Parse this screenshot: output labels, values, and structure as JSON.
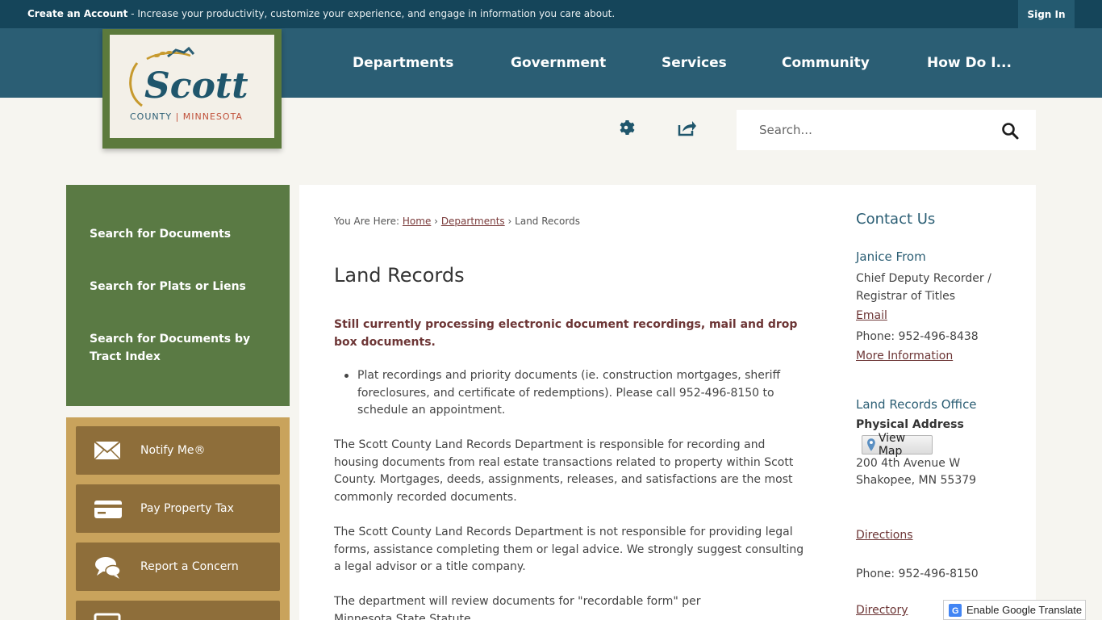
{
  "topbar": {
    "create_account": "Create an Account",
    "promo_text": " - Increase your productivity, customize your experience, and engage in information you care about.",
    "sign_in": "Sign In"
  },
  "logo": {
    "name": "Scott",
    "subtitle_left": "COUNTY",
    "subtitle_right": "MINNESOTA"
  },
  "nav": {
    "items": [
      "Departments",
      "Government",
      "Services",
      "Community",
      "How Do I..."
    ]
  },
  "utility": {
    "settings_icon": "gear-icon",
    "share_icon": "share-icon"
  },
  "search": {
    "placeholder": "Search...",
    "icon": "search-icon"
  },
  "sidenav": {
    "items": [
      "Search for Documents",
      "Search for Plats or Liens",
      "Search for Documents by Tract Index"
    ]
  },
  "quicklinks": [
    {
      "label": "Notify Me®",
      "icon": "envelope-icon"
    },
    {
      "label": "Pay Property Tax",
      "icon": "credit-card-icon"
    },
    {
      "label": "Report a Concern",
      "icon": "chat-bubbles-icon"
    },
    {
      "label": "",
      "icon": "monitor-icon"
    }
  ],
  "breadcrumb": {
    "prefix": "You Are Here:",
    "home": "Home",
    "departments": "Departments",
    "current": "Land Records",
    "sep": "›"
  },
  "page": {
    "title": "Land Records",
    "alert": "Still currently processing electronic document recordings, mail and drop box documents.",
    "bullet": "Plat recordings and priority documents (ie. construction mortgages, sheriff foreclosures, and certificate of redemptions).  Please call 952-496-8150 to schedule an appointment.",
    "para1": "The Scott County Land Records Department is responsible for recording and housing documents from real estate transactions related to property within Scott County. Mortgages, deeds, assignments, releases, and satisfactions are the most commonly recorded documents.",
    "para2": "The Scott County Land Records Department is not responsible for providing legal forms, assistance completing them or legal advice. We strongly suggest consulting a legal advisor or a title company.",
    "para3_text": "The department will review documents for \"recordable form\" per ",
    "para3_link": "Minnesota State Statute"
  },
  "contact": {
    "heading": "Contact Us",
    "person_name": "Janice From",
    "person_title": "Chief Deputy Recorder / Registrar of Titles",
    "email": "Email",
    "phone1": "Phone: 952-496-8438",
    "more_info": "More Information",
    "office": "Land Records Office",
    "physical_address_label": "Physical Address",
    "view_map": "View Map",
    "address1": "200 4th Avenue W",
    "address2": "Shakopee, MN 55379",
    "directions": "Directions",
    "phone2": "Phone: 952-496-8150",
    "directory": "Directory"
  },
  "translate": {
    "label": "Enable Google Translate"
  },
  "colors": {
    "topbar": "#15455a",
    "nav": "#2b5e74",
    "sidenav": "#5a7a44",
    "quicklinks": "#c9a35c",
    "quickbtn": "#8e6e3a",
    "alert": "#6d3636"
  }
}
